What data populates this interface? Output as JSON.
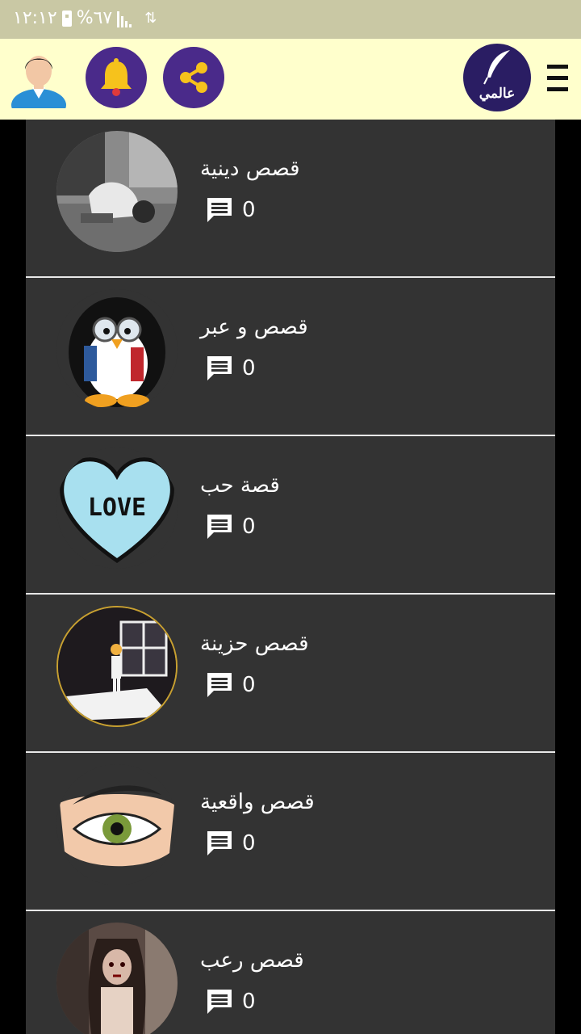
{
  "status_bar": {
    "time": "١٢:١٢",
    "battery": "%٦٧"
  },
  "app_bar": {
    "logo_text": "عالمي",
    "colors": {
      "appbar_bg": "#ffffcc",
      "button_bg": "#4a2a8a",
      "accent": "#f6c21c"
    }
  },
  "categories": [
    {
      "title": "قصص دينية",
      "comments": "0",
      "icon": "prayer-image"
    },
    {
      "title": "قصص و عبر",
      "comments": "0",
      "icon": "penguin-image"
    },
    {
      "title": "قصة حب",
      "comments": "0",
      "icon": "love-heart-image"
    },
    {
      "title": "قصص حزينة",
      "comments": "0",
      "icon": "sad-window-image"
    },
    {
      "title": "قصص واقعية",
      "comments": "0",
      "icon": "eye-image"
    },
    {
      "title": "قصص رعب",
      "comments": "0",
      "icon": "horror-image"
    }
  ]
}
